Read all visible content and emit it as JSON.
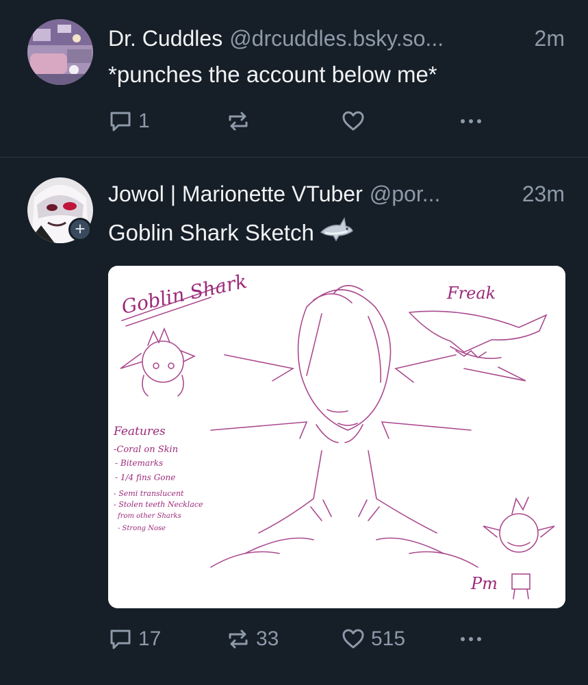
{
  "posts": [
    {
      "author_name": "Dr. Cuddles",
      "handle": "@drcuddles.bsky.so...",
      "time": "2m",
      "text": "*punches the account below me*",
      "reply_count": "1",
      "repost_count": "",
      "like_count": ""
    },
    {
      "author_name": "Jowol | Marionette VTuber",
      "handle": "@por...",
      "time": "23m",
      "text": "Goblin Shark Sketch",
      "reply_count": "17",
      "repost_count": "33",
      "like_count": "515",
      "image": {
        "title": "Goblin Shark",
        "freak_label": "Freak",
        "features_heading": "Features",
        "features": [
          "-Coral on Skin",
          "- Bitemarks",
          "- 1/4 fins Gone",
          "- Semi translucent",
          "- Stolen teeth Necklace",
          "from other Sharks",
          "- Strong Nose"
        ],
        "signature": "Pm"
      }
    }
  ],
  "icons": {
    "reply": "reply-icon",
    "repost": "repost-icon",
    "like": "heart-icon",
    "more": "more-icon",
    "follow": "plus-icon"
  },
  "colors": {
    "background": "#161e27",
    "text": "#f1f3f5",
    "muted": "#8d9aa9",
    "divider": "#2e3b4b",
    "sketch_ink": "#9c2a7a"
  }
}
